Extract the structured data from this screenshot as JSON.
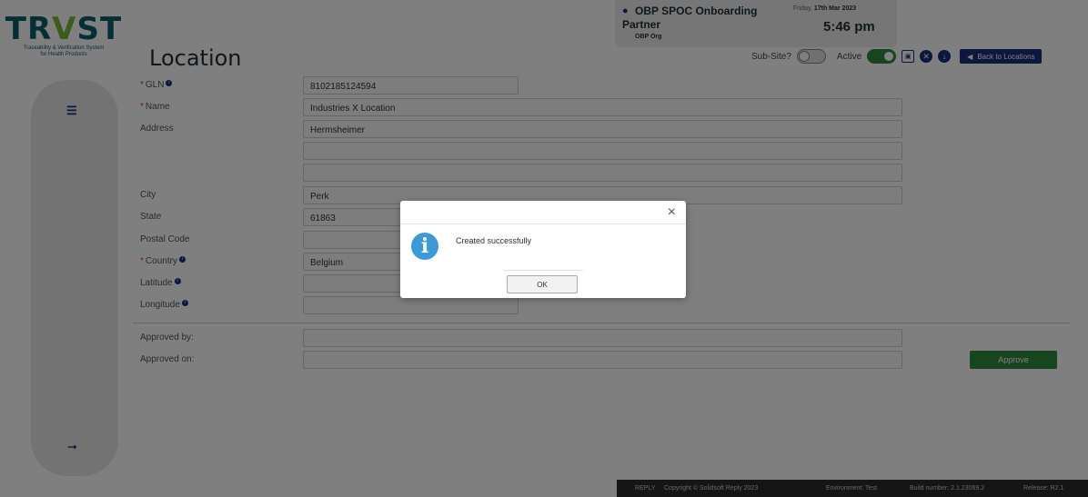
{
  "brand": {
    "logo": "TRVST",
    "tagline_1": "Traceability & Verification System",
    "tagline_2": "for Health Products"
  },
  "page_title": "Location",
  "user": {
    "name_line1": "OBP SPOC Onboarding",
    "name_line2": "Partner",
    "org": "OBP Org",
    "day": "Friday,",
    "date": "17th Mar 2023",
    "time": "5:46 pm"
  },
  "toolbar": {
    "sub_site_label": "Sub-Site?",
    "sub_site_on": false,
    "active_label": "Active",
    "active_on": true,
    "back_label": "Back to Locations"
  },
  "form": {
    "gln": {
      "label": "GLN",
      "value": "8102185124594"
    },
    "name": {
      "label": "Name",
      "value": "Industries X Location"
    },
    "address": {
      "label": "Address",
      "line1": "Hermsheimer",
      "line2": "",
      "line3": ""
    },
    "city": {
      "label": "City",
      "value": "Perk"
    },
    "state": {
      "label": "State",
      "value": "61863"
    },
    "postal_code": {
      "label": "Postal Code",
      "value": ""
    },
    "country": {
      "label": "Country",
      "value": "Belgium"
    },
    "latitude": {
      "label": "Latitude",
      "value": ""
    },
    "longitude": {
      "label": "Longitude",
      "value": ""
    },
    "approved_by": {
      "label": "Approved by:",
      "value": ""
    },
    "approved_on": {
      "label": "Approved on:",
      "value": ""
    },
    "approve_button": "Approve"
  },
  "footer": {
    "brand": "REPLY",
    "copyright": "Copyright © Solidsoft Reply 2023",
    "environment": "Environment: Test",
    "build": "Build number: 2.1.23069.2",
    "release": "Release: R2.1"
  },
  "dialog": {
    "message": "Created successfully",
    "ok_label": "OK",
    "close_glyph": "×"
  }
}
